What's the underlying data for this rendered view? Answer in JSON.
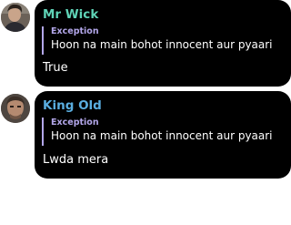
{
  "messages": [
    {
      "sender": "Mr Wick",
      "sender_color": "#5fd3b6",
      "avatar_icon": "user-photo-avatar",
      "reply": {
        "title": "Exception",
        "text": "Hoon na main bohot innocent aur pyaari"
      },
      "text": "True"
    },
    {
      "sender": "King Old",
      "sender_color": "#5aaee0",
      "avatar_icon": "user-photo-avatar",
      "reply": {
        "title": "Exception",
        "text": "Hoon na main bohot innocent aur pyaari"
      },
      "text": "Lwda mera"
    }
  ],
  "colors": {
    "bubble": "#000000",
    "reply_accent": "#b3a7ea",
    "text": "#ffffff",
    "background": "#ffffff"
  }
}
